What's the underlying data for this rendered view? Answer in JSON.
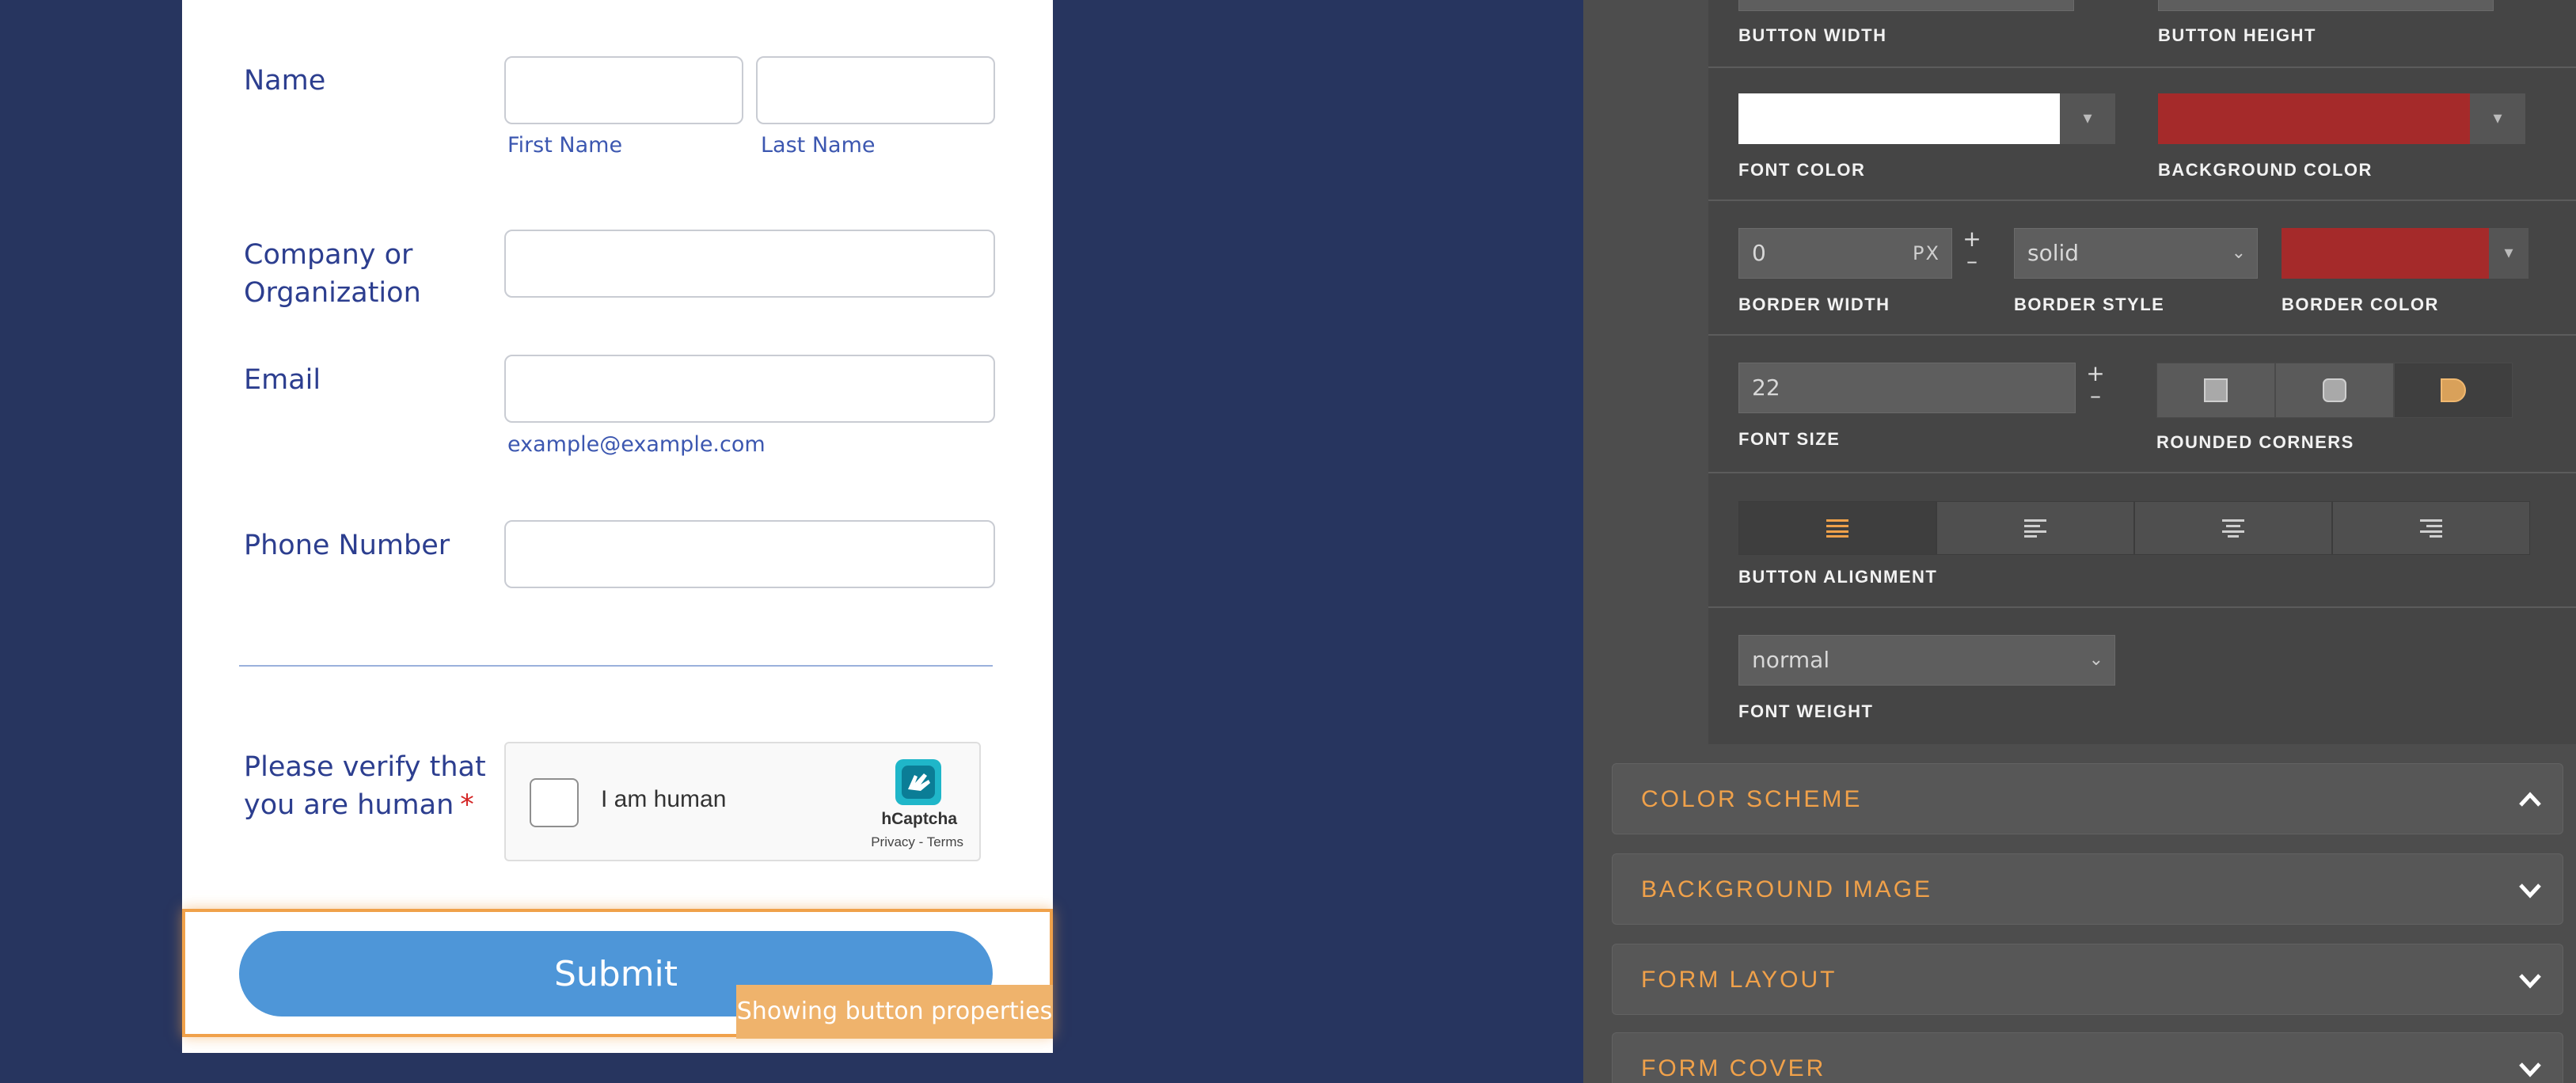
{
  "form": {
    "name_label": "Name",
    "first_name_sublabel": "First Name",
    "last_name_sublabel": "Last Name",
    "company_label_line1": "Company or",
    "company_label_line2": "Organization",
    "email_label": "Email",
    "email_sublabel": "example@example.com",
    "phone_label": "Phone Number",
    "verify_label_line1": "Please verify that",
    "verify_label_line2": "you are human",
    "required_mark": "*",
    "captcha": {
      "checkbox_label": "I am human",
      "brand": "hCaptcha",
      "links": "Privacy - Terms"
    },
    "submit_label": "Submit",
    "tooltip": "Showing button properties"
  },
  "properties": {
    "button_width_label": "BUTTON WIDTH",
    "button_height_label": "BUTTON HEIGHT",
    "font_color_label": "FONT COLOR",
    "font_color_value": "#ffffff",
    "background_color_label": "BACKGROUND COLOR",
    "background_color_value": "#a52a2a",
    "border_width_label": "BORDER WIDTH",
    "border_width_value": "0",
    "border_width_unit": "PX",
    "border_style_label": "BORDER STYLE",
    "border_style_value": "solid",
    "border_color_label": "BORDER COLOR",
    "border_color_value": "#a52a2a",
    "font_size_label": "FONT SIZE",
    "font_size_value": "22",
    "rounded_corners_label": "ROUNDED CORNERS",
    "rounded_corners_selected": "rounded",
    "button_alignment_label": "BUTTON ALIGNMENT",
    "button_alignment_selected": "auto",
    "font_weight_label": "FONT WEIGHT",
    "font_weight_value": "normal",
    "stepper_plus": "+",
    "stepper_minus": "–",
    "dropdown_arrow": "▾"
  },
  "sections": [
    {
      "title": "COLOR SCHEME",
      "state": "expanded"
    },
    {
      "title": "BACKGROUND IMAGE",
      "state": "collapsed"
    },
    {
      "title": "FORM LAYOUT",
      "state": "collapsed"
    },
    {
      "title": "FORM COVER",
      "state": "collapsed"
    }
  ],
  "colors": {
    "page_background": "#27355f",
    "label_blue": "#2c3e8f",
    "submit_blue": "#4e96d8",
    "highlight_orange": "#f0a14a",
    "accent_orange": "#f0a14a",
    "panel_dark": "#454545"
  },
  "icons": {
    "captcha_logo": "hcaptcha-logo-icon",
    "corner_square": "square-corner-icon",
    "corner_rounded": "rounded-corner-icon",
    "corner_pill": "pill-corner-icon",
    "align_auto": "align-justify-icon",
    "align_left": "align-left-icon",
    "align_center": "align-center-icon",
    "align_right": "align-right-icon",
    "chevron_up": "chevron-up-icon",
    "chevron_down": "chevron-down-icon"
  }
}
